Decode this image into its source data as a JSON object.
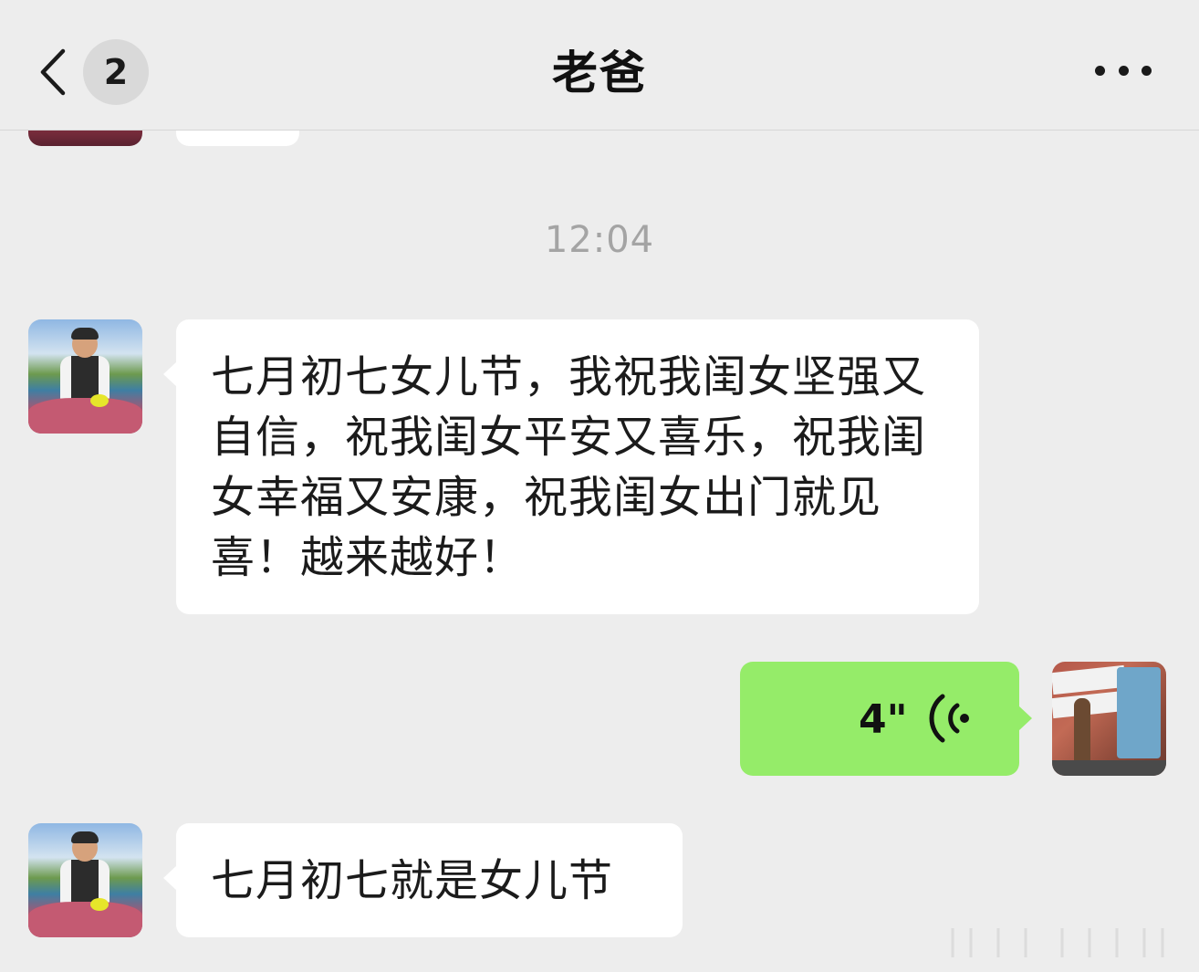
{
  "header": {
    "back_icon": "chevron-left-icon",
    "unread_count": "2",
    "title": "老爸",
    "more_icon": "ellipsis-icon"
  },
  "timestamp": "12:04",
  "messages": [
    {
      "sender": "contact",
      "type": "text",
      "text": "七月初七女儿节，我祝我闺女坚强又自信，祝我闺女平安又喜乐，祝我闺女幸福又安康，祝我闺女出门就见喜！越来越好！"
    },
    {
      "sender": "me",
      "type": "voice",
      "duration": "4\"",
      "icon": "voice-wave-icon"
    },
    {
      "sender": "contact",
      "type": "text",
      "text": "七月初七就是女儿节"
    }
  ],
  "colors": {
    "background": "#ededed",
    "incoming_bubble": "#ffffff",
    "outgoing_bubble": "#95ec69",
    "timestamp": "#a4a4a4"
  }
}
